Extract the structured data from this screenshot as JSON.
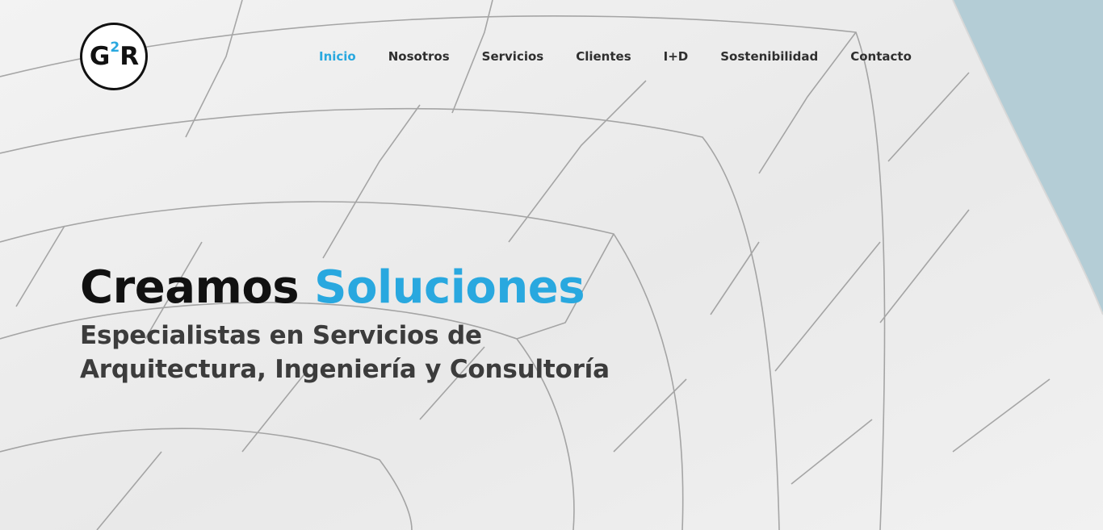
{
  "brand": {
    "logo_main_left": "G",
    "logo_superscript": "2",
    "logo_main_right": "R",
    "accent_color": "#29a8df",
    "text_color": "#111111"
  },
  "nav": {
    "items": [
      {
        "label": "Inicio",
        "active": true
      },
      {
        "label": "Nosotros",
        "active": false
      },
      {
        "label": "Servicios",
        "active": false
      },
      {
        "label": "Clientes",
        "active": false
      },
      {
        "label": "I+D",
        "active": false
      },
      {
        "label": "Sostenibilidad",
        "active": false
      },
      {
        "label": "Contacto",
        "active": false
      }
    ]
  },
  "hero": {
    "title_plain": "Creamos",
    "title_accent": "Soluciones",
    "subtitle_line1": "Especialistas en Servicios de",
    "subtitle_line2": "Arquitectura, Ingeniería y Consultoría",
    "background_sky_color": "#b4cdd6"
  }
}
